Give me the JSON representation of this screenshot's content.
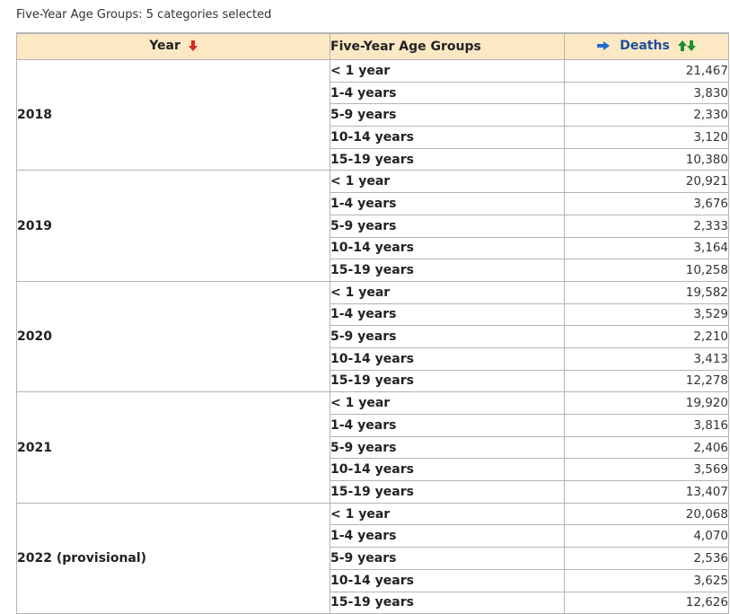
{
  "caption": "Five-Year Age Groups: 5 categories selected",
  "headers": {
    "year": "Year",
    "age_groups": "Five-Year Age Groups",
    "deaths": "Deaths"
  },
  "colors": {
    "header_bg": "#fde8c4",
    "sort_arrow_red": "#d9261c",
    "sort_arrow_green": "#1e8f2e",
    "link_blue": "#1f4e9b"
  },
  "icons": {
    "year_sort": "arrow-down-red-icon",
    "deaths_pointer": "arrow-right-blue-icon",
    "deaths_sort": "arrows-up-down-green-icon"
  },
  "groups": [
    {
      "year": "2018",
      "rows": [
        {
          "age": "< 1 year",
          "deaths": "21,467"
        },
        {
          "age": "1-4 years",
          "deaths": "3,830"
        },
        {
          "age": "5-9 years",
          "deaths": "2,330"
        },
        {
          "age": "10-14 years",
          "deaths": "3,120"
        },
        {
          "age": "15-19 years",
          "deaths": "10,380"
        }
      ]
    },
    {
      "year": "2019",
      "rows": [
        {
          "age": "< 1 year",
          "deaths": "20,921"
        },
        {
          "age": "1-4 years",
          "deaths": "3,676"
        },
        {
          "age": "5-9 years",
          "deaths": "2,333"
        },
        {
          "age": "10-14 years",
          "deaths": "3,164"
        },
        {
          "age": "15-19 years",
          "deaths": "10,258"
        }
      ]
    },
    {
      "year": "2020",
      "rows": [
        {
          "age": "< 1 year",
          "deaths": "19,582"
        },
        {
          "age": "1-4 years",
          "deaths": "3,529"
        },
        {
          "age": "5-9 years",
          "deaths": "2,210"
        },
        {
          "age": "10-14 years",
          "deaths": "3,413"
        },
        {
          "age": "15-19 years",
          "deaths": "12,278"
        }
      ]
    },
    {
      "year": "2021",
      "rows": [
        {
          "age": "< 1 year",
          "deaths": "19,920"
        },
        {
          "age": "1-4 years",
          "deaths": "3,816"
        },
        {
          "age": "5-9 years",
          "deaths": "2,406"
        },
        {
          "age": "10-14 years",
          "deaths": "3,569"
        },
        {
          "age": "15-19 years",
          "deaths": "13,407"
        }
      ]
    },
    {
      "year": "2022 (provisional)",
      "rows": [
        {
          "age": "< 1 year",
          "deaths": "20,068"
        },
        {
          "age": "1-4 years",
          "deaths": "4,070"
        },
        {
          "age": "5-9 years",
          "deaths": "2,536"
        },
        {
          "age": "10-14 years",
          "deaths": "3,625"
        },
        {
          "age": "15-19 years",
          "deaths": "12,626"
        }
      ]
    }
  ]
}
